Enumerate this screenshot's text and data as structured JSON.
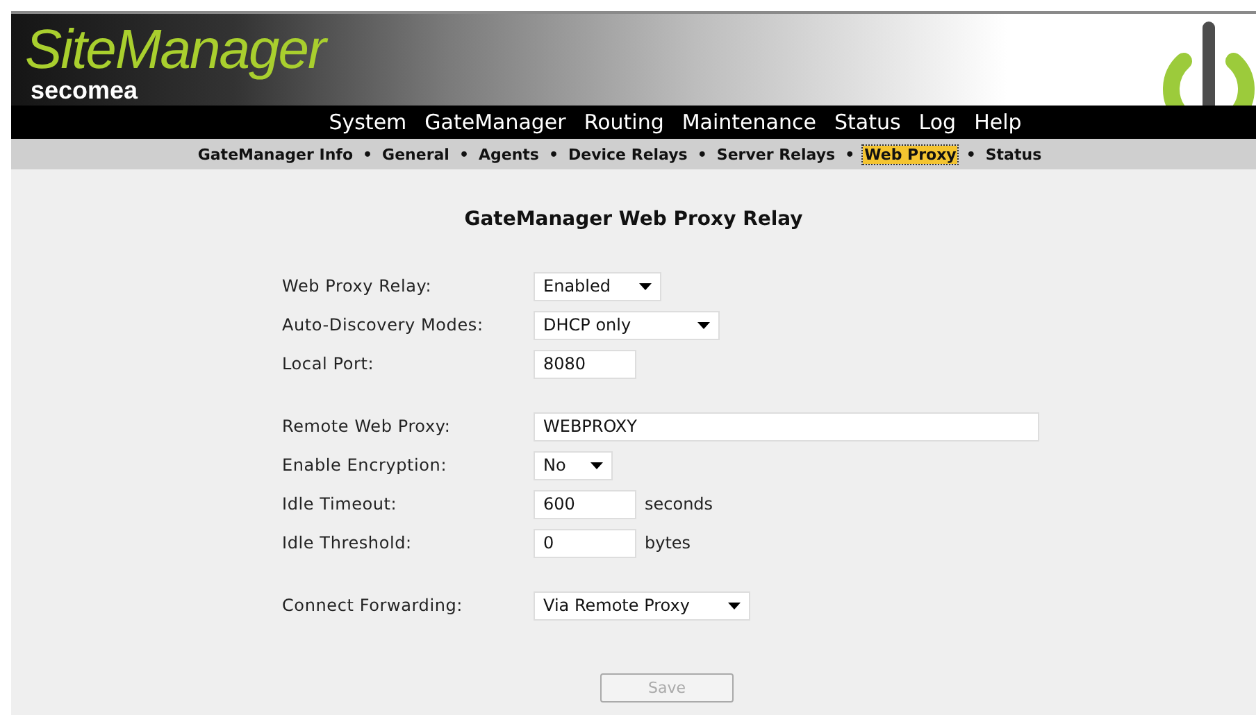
{
  "header": {
    "product": "SiteManager",
    "brand": "secomea"
  },
  "menu": [
    "System",
    "GateManager",
    "Routing",
    "Maintenance",
    "Status",
    "Log",
    "Help"
  ],
  "submenu": [
    {
      "label": "GateManager Info",
      "selected": false
    },
    {
      "label": "General",
      "selected": false
    },
    {
      "label": "Agents",
      "selected": false
    },
    {
      "label": "Device Relays",
      "selected": false
    },
    {
      "label": "Server Relays",
      "selected": false
    },
    {
      "label": "Web Proxy",
      "selected": true
    },
    {
      "label": "Status",
      "selected": false
    }
  ],
  "separator": "•",
  "title": "GateManager Web Proxy Relay",
  "groups": [
    [
      {
        "label": "Web Proxy Relay:",
        "kind": "select",
        "value": "Enabled"
      },
      {
        "label": "Auto-Discovery Modes:",
        "kind": "select",
        "value": "DHCP only"
      },
      {
        "label": "Local Port:",
        "kind": "input",
        "value": "8080"
      }
    ],
    [
      {
        "label": "Remote Web Proxy:",
        "kind": "input",
        "value": "WEBPROXY"
      },
      {
        "label": "Enable Encryption:",
        "kind": "select",
        "value": "No"
      },
      {
        "label": "Idle Timeout:",
        "kind": "input",
        "value": "600",
        "unit": "seconds"
      },
      {
        "label": "Idle Threshold:",
        "kind": "input",
        "value": "0",
        "unit": "bytes"
      }
    ],
    [
      {
        "label": "Connect Forwarding:",
        "kind": "select",
        "value": "Via Remote Proxy"
      }
    ]
  ],
  "save": {
    "label": "Save",
    "disabled": true
  }
}
